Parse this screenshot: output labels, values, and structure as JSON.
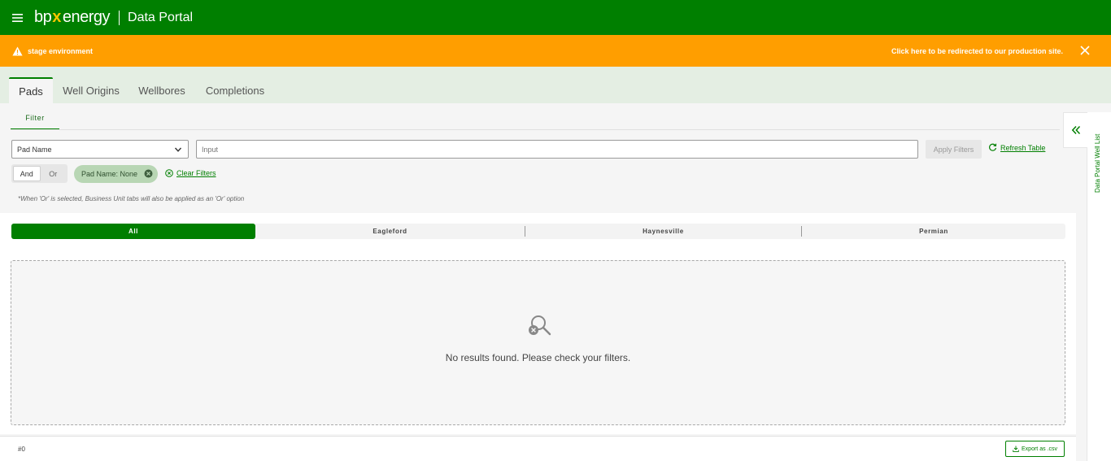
{
  "header": {
    "logo_bp": "bp",
    "logo_x": "x",
    "logo_energy": "energy",
    "app_title": "Data Portal"
  },
  "banner": {
    "environment": "stage environment",
    "redirect": "Click here to be redirected to our production site."
  },
  "tabs": [
    {
      "label": "Pads",
      "active": true
    },
    {
      "label": "Well Origins",
      "active": false
    },
    {
      "label": "Wellbores",
      "active": false
    },
    {
      "label": "Completions",
      "active": false
    }
  ],
  "subtab": "Filter",
  "filter": {
    "field": "Pad Name",
    "input_placeholder": "Input",
    "apply": "Apply Filters",
    "refresh": "Refresh Table",
    "and": "And",
    "or": "Or",
    "chip": "Pad Name: None",
    "clear": "Clear Filters",
    "note": "*When 'Or' is selected, Business Unit tabs will also be applied as an 'Or' option"
  },
  "business_units": [
    {
      "label": "All",
      "active": true
    },
    {
      "label": "Eagleford",
      "active": false
    },
    {
      "label": "Haynesville",
      "active": false
    },
    {
      "label": "Permian",
      "active": false
    }
  ],
  "empty_state": {
    "message": "No results found. Please check your filters.",
    "icon": "search-no-results-icon"
  },
  "footer": {
    "count": "#0",
    "export": "Export as .csv"
  },
  "side_panel": {
    "label": "Data Portal Well List"
  },
  "colors": {
    "brand_green": "#007f00",
    "warning_orange": "#ff9e00",
    "logo_x": "#f7c600"
  }
}
